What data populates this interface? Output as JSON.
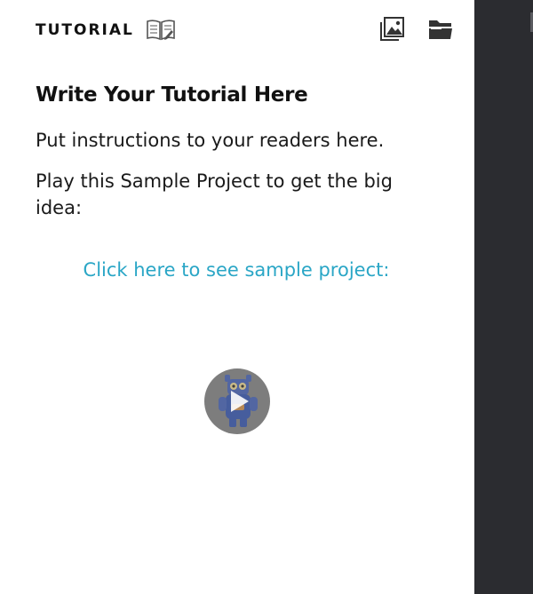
{
  "header": {
    "title": "TUTORIAL",
    "icons": [
      "open-book-icon",
      "image-gallery-icon",
      "folder-icon"
    ]
  },
  "tutorial": {
    "heading": "Write Your Tutorial Here",
    "paragraph1": "Put instructions to your readers here.",
    "paragraph2": "Play this Sample Project to get the big idea:",
    "link_text": "Click here to see sample project:"
  },
  "colors": {
    "link": "#2aa6c6",
    "side_panel": "#2b2c30",
    "play_button": "#7d7d7d"
  }
}
